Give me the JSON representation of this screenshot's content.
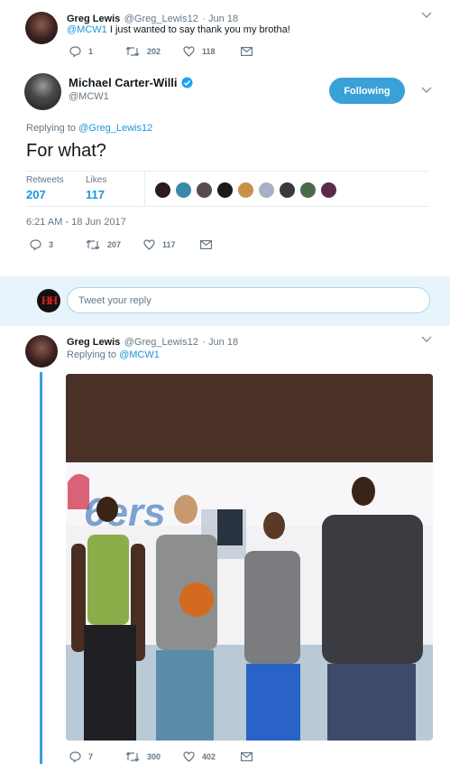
{
  "tweet1": {
    "name": "Greg Lewis",
    "handle": "@Greg_Lewis12",
    "date": "· Jun 18",
    "mention": "@MCW1",
    "text": " I just wanted to say thank you my brotha!",
    "replies": "1",
    "retweets": "202",
    "likes": "118"
  },
  "main_tweet": {
    "name": "Michael Carter-Willi",
    "handle": "@MCW1",
    "follow_label": "Following",
    "replying_prefix": "Replying to ",
    "replying_to": "@Greg_Lewis12",
    "text": "For what?",
    "retweets_label": "Retweets",
    "retweets_count": "207",
    "likes_label": "Likes",
    "likes_count": "117",
    "timestamp": "6:21 AM - 18 Jun 2017",
    "replies": "3",
    "retweet_action_count": "207",
    "like_action_count": "117"
  },
  "reply_box": {
    "avatar_text": "HH",
    "placeholder": "Tweet your reply"
  },
  "tweet3": {
    "name": "Greg Lewis",
    "handle": "@Greg_Lewis12",
    "date": "· Jun 18",
    "replying_prefix": "Replying to ",
    "replying_to": "@MCW1",
    "photo_banner_text": "6ers",
    "replies": "7",
    "retweets": "300",
    "likes": "402"
  },
  "colors": {
    "accent": "#1b95e0",
    "follow_button": "#3aa0d8",
    "verified": "#1da1f2",
    "reply_bar_bg": "#e8f4fb"
  }
}
